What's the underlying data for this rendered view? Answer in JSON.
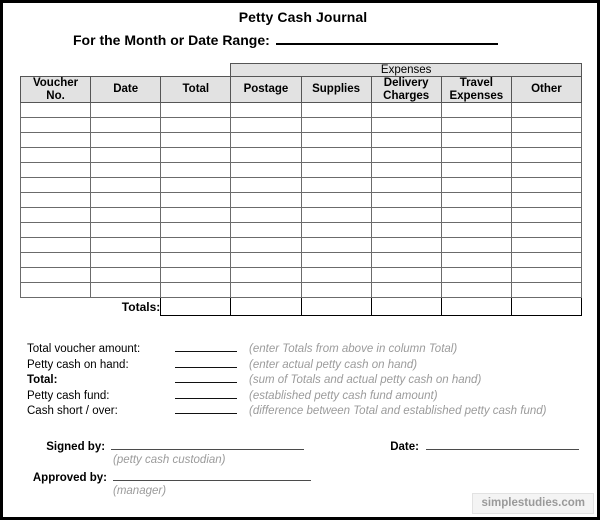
{
  "document": {
    "title": "Petty Cash Journal",
    "date_range_label": "For the Month or Date Range:",
    "date_range_value": ""
  },
  "table": {
    "group_header": "Expenses",
    "columns": [
      "Voucher No.",
      "Date",
      "Total",
      "Postage",
      "Supplies",
      "Delivery Charges",
      "Travel Expenses",
      "Other"
    ],
    "columns_line1": [
      "Voucher",
      "Date",
      "Total",
      "Postage",
      "Supplies",
      "Delivery",
      "Travel",
      "Other"
    ],
    "columns_line2": [
      "No.",
      "",
      "",
      "",
      "",
      "Charges",
      "Expenses",
      ""
    ],
    "body_row_count": 13,
    "totals_label": "Totals:",
    "rows": []
  },
  "summary": {
    "rows": [
      {
        "label": "Total voucher amount:",
        "value": "",
        "hint": "(enter Totals from above in column Total)",
        "bold": false
      },
      {
        "label": "Petty cash on hand:",
        "value": "",
        "hint": "(enter actual petty cash on hand)",
        "bold": false
      },
      {
        "label": "Total:",
        "value": "",
        "hint": "(sum of Totals and actual petty cash on hand)",
        "bold": true
      },
      {
        "label": "Petty cash fund:",
        "value": "",
        "hint": "(established petty cash fund amount)",
        "bold": false
      },
      {
        "label": "Cash short / over:",
        "value": "",
        "hint": "(difference between Total and established petty cash fund)",
        "bold": false
      }
    ]
  },
  "signatures": {
    "signed_by_label": "Signed by:",
    "signed_by_value": "",
    "signed_by_hint": "(petty cash custodian)",
    "approved_by_label": "Approved by:",
    "approved_by_value": "",
    "approved_by_hint": "(manager)",
    "date_label": "Date:",
    "date_value": ""
  },
  "watermark": {
    "text": "simplestudies.com"
  },
  "colors": {
    "header_fill": "#e2e2e2",
    "grid_line": "#6b6b6b",
    "hint_text": "#9b9b9b",
    "page_border": "#000000",
    "watermark_text": "#9a9a9a"
  }
}
